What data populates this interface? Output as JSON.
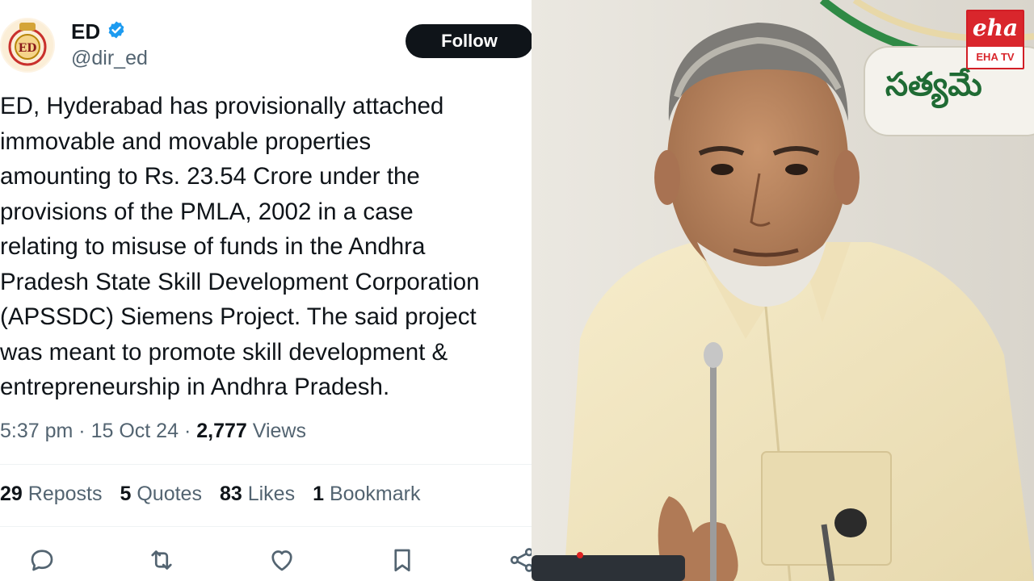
{
  "tweet": {
    "display_name": "ED",
    "handle": "@dir_ed",
    "verified": true,
    "follow_label": "Follow",
    "text": "ED, Hyderabad has provisionally attached\nimmovable and movable properties\namounting to Rs. 23.54 Crore under the\nprovisions of the PMLA, 2002 in a case\nrelating to misuse of funds in the Andhra\nPradesh State Skill Development Corporation\n(APSSDC) Siemens Project. The said project\nwas meant to promote skill development &\nentrepreneurship in Andhra Pradesh.",
    "time": "5:37 pm",
    "date": "15 Oct 24",
    "views_count": "2,777",
    "views_label": "Views",
    "stats": {
      "reposts_count": "29",
      "reposts_label": "Reposts",
      "quotes_count": "5",
      "quotes_label": "Quotes",
      "likes_count": "83",
      "likes_label": "Likes",
      "bookmarks_count": "1",
      "bookmarks_label": "Bookmark"
    },
    "actions": [
      "reply-icon",
      "repost-icon",
      "like-icon",
      "bookmark-icon",
      "share-icon"
    ]
  },
  "photo": {
    "logo_main": "eha",
    "logo_sub": "EHA TV",
    "wall_text": "సత్యమే"
  },
  "colors": {
    "text_primary": "#0f1419",
    "text_secondary": "#536471",
    "follow_bg": "#0f1419",
    "verified_blue": "#1d9bf0",
    "logo_red": "#d9262c"
  }
}
